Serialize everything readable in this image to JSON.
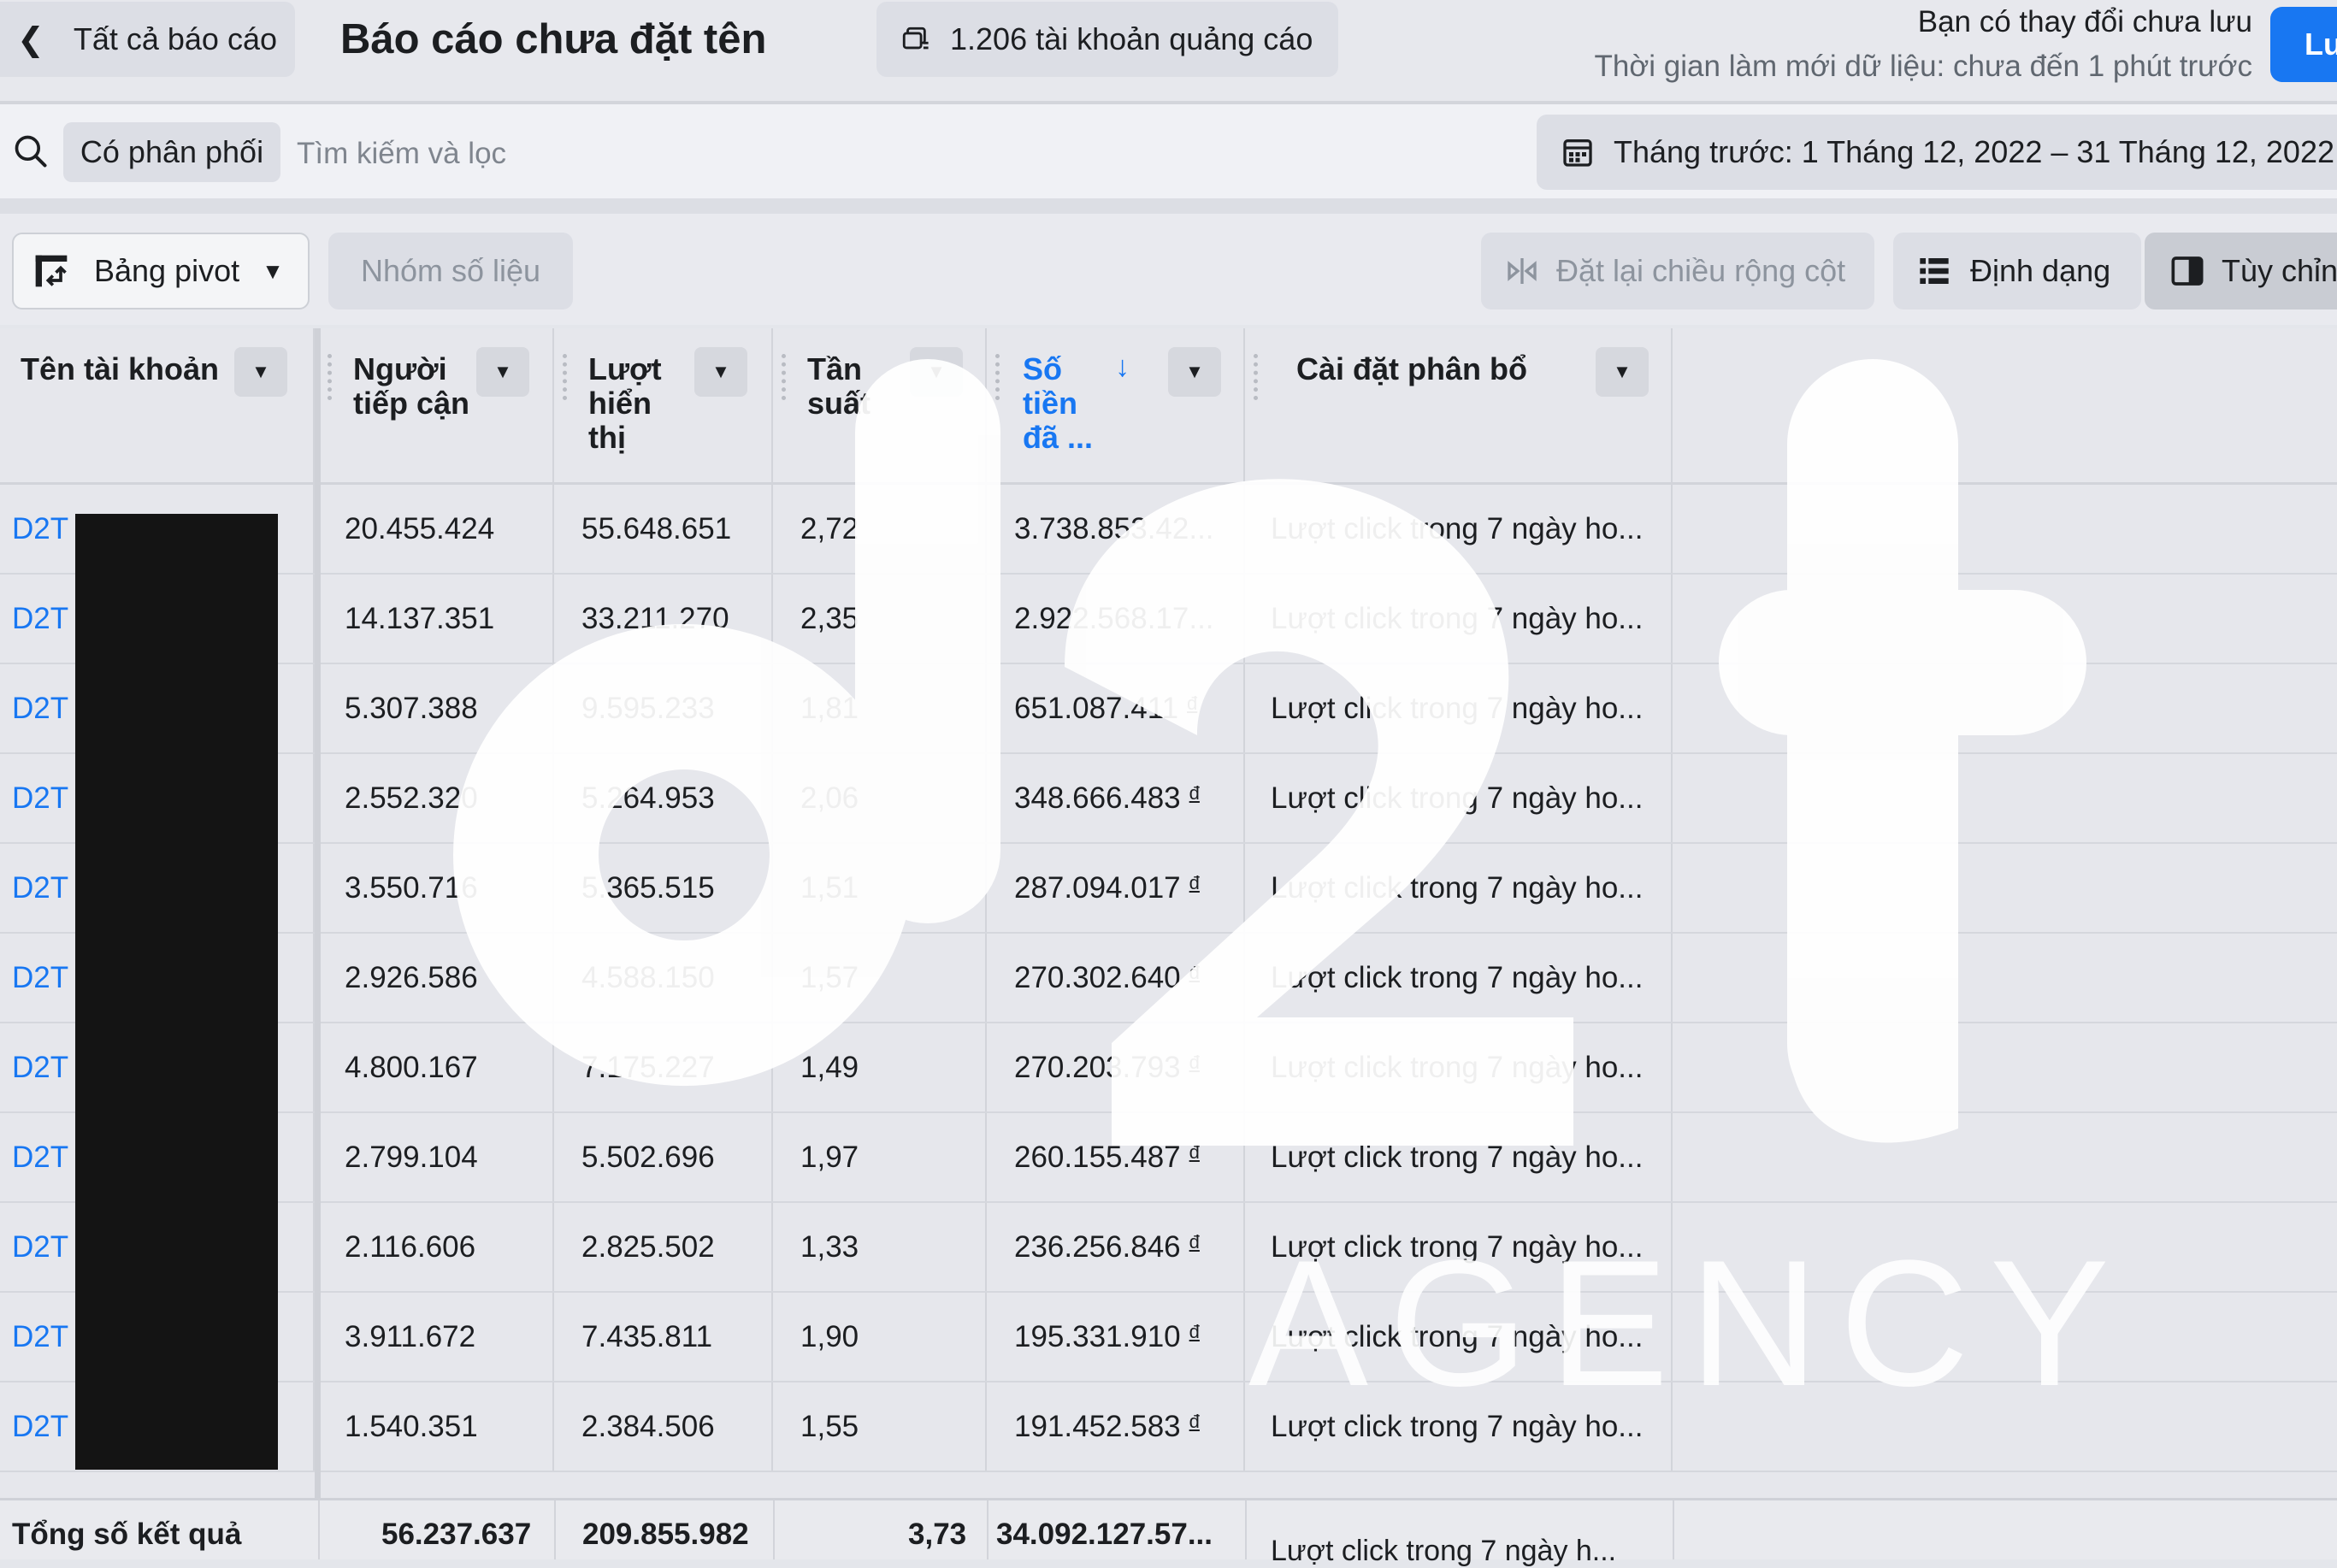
{
  "header": {
    "back_label": "Tất cả báo cáo",
    "title": "Báo cáo chưa đặt tên",
    "accounts_label": "1.206 tài khoản quảng cáo",
    "unsaved_text": "Bạn có thay đổi chưa lưu",
    "refresh_text": "Thời gian làm mới dữ liệu: chưa đến 1 phút trước",
    "save_label": "Lu"
  },
  "search": {
    "chip_label": "Có phân phối",
    "placeholder": "Tìm kiếm và lọc",
    "date_range": "Tháng trước: 1 Tháng 12, 2022 – 31 Tháng 12, 2022"
  },
  "toolbar": {
    "pivot_label": "Bảng pivot",
    "metric_group_label": "Nhóm số liệu",
    "reset_width_label": "Đặt lại chiều rộng cột",
    "format_label": "Định dạng",
    "customize_label": "Tùy chỉnh"
  },
  "columns": {
    "account": "Tên tài khoản",
    "reach_1": "Người",
    "reach_2": "tiếp cận",
    "impr_1": "Lượt",
    "impr_2": "hiển",
    "impr_3": "thị",
    "freq_1": "Tần",
    "freq_2": "suất",
    "spend_1": "Số",
    "spend_2": "tiền",
    "spend_3": "đã ...",
    "attribution": "Cài đặt phân bổ"
  },
  "rows": [
    {
      "account": "D2T",
      "reach": "20.455.424",
      "impressions": "55.648.651",
      "frequency": "2,72",
      "spend": "3.738.853.42...",
      "currency": "",
      "attribution": "Lượt click trong 7 ngày ho..."
    },
    {
      "account": "D2T",
      "reach": "14.137.351",
      "impressions": "33.211.270",
      "frequency": "2,35",
      "spend": "2.922.568.17...",
      "currency": "",
      "attribution": "Lượt click trong 7 ngày ho..."
    },
    {
      "account": "D2T",
      "reach": "5.307.388",
      "impressions": "9.595.233",
      "frequency": "1,81",
      "spend": "651.087.411",
      "currency": "đ",
      "attribution": "Lượt click trong 7 ngày ho..."
    },
    {
      "account": "D2T",
      "reach": "2.552.320",
      "impressions": "5.264.953",
      "frequency": "2,06",
      "spend": "348.666.483",
      "currency": "đ",
      "attribution": "Lượt click trong 7 ngày ho..."
    },
    {
      "account": "D2T",
      "reach": "3.550.716",
      "impressions": "5.365.515",
      "frequency": "1,51",
      "spend": "287.094.017",
      "currency": "đ",
      "attribution": "Lượt click trong 7 ngày ho..."
    },
    {
      "account": "D2T",
      "reach": "2.926.586",
      "impressions": "4.588.150",
      "frequency": "1,57",
      "spend": "270.302.640",
      "currency": "đ",
      "attribution": "Lượt click trong 7 ngày ho..."
    },
    {
      "account": "D2T",
      "reach": "4.800.167",
      "impressions": "7.175.227",
      "frequency": "1,49",
      "spend": "270.203.793",
      "currency": "đ",
      "attribution": "Lượt click trong 7 ngày ho..."
    },
    {
      "account": "D2T",
      "reach": "2.799.104",
      "impressions": "5.502.696",
      "frequency": "1,97",
      "spend": "260.155.487",
      "currency": "đ",
      "attribution": "Lượt click trong 7 ngày ho..."
    },
    {
      "account": "D2T",
      "reach": "2.116.606",
      "impressions": "2.825.502",
      "frequency": "1,33",
      "spend": "236.256.846",
      "currency": "đ",
      "attribution": "Lượt click trong 7 ngày ho..."
    },
    {
      "account": "D2T",
      "reach": "3.911.672",
      "impressions": "7.435.811",
      "frequency": "1,90",
      "spend": "195.331.910",
      "currency": "đ",
      "attribution": "Lượt click trong 7 ngày ho..."
    },
    {
      "account": "D2T",
      "reach": "1.540.351",
      "impressions": "2.384.506",
      "frequency": "1,55",
      "spend": "191.452.583",
      "currency": "đ",
      "attribution": "Lượt click trong 7 ngày ho..."
    }
  ],
  "totals": {
    "label": "Tổng số kết quả",
    "reach": "56.237.637",
    "impressions": "209.855.982",
    "frequency": "3,73",
    "spend": "34.092.127.57...",
    "attribution": "Lượt click trong 7 ngày h..."
  },
  "watermark": {
    "brand": "AGENCY"
  },
  "colors": {
    "accent": "#1877f2",
    "link": "#1877f2",
    "text": "#1c1e21"
  }
}
